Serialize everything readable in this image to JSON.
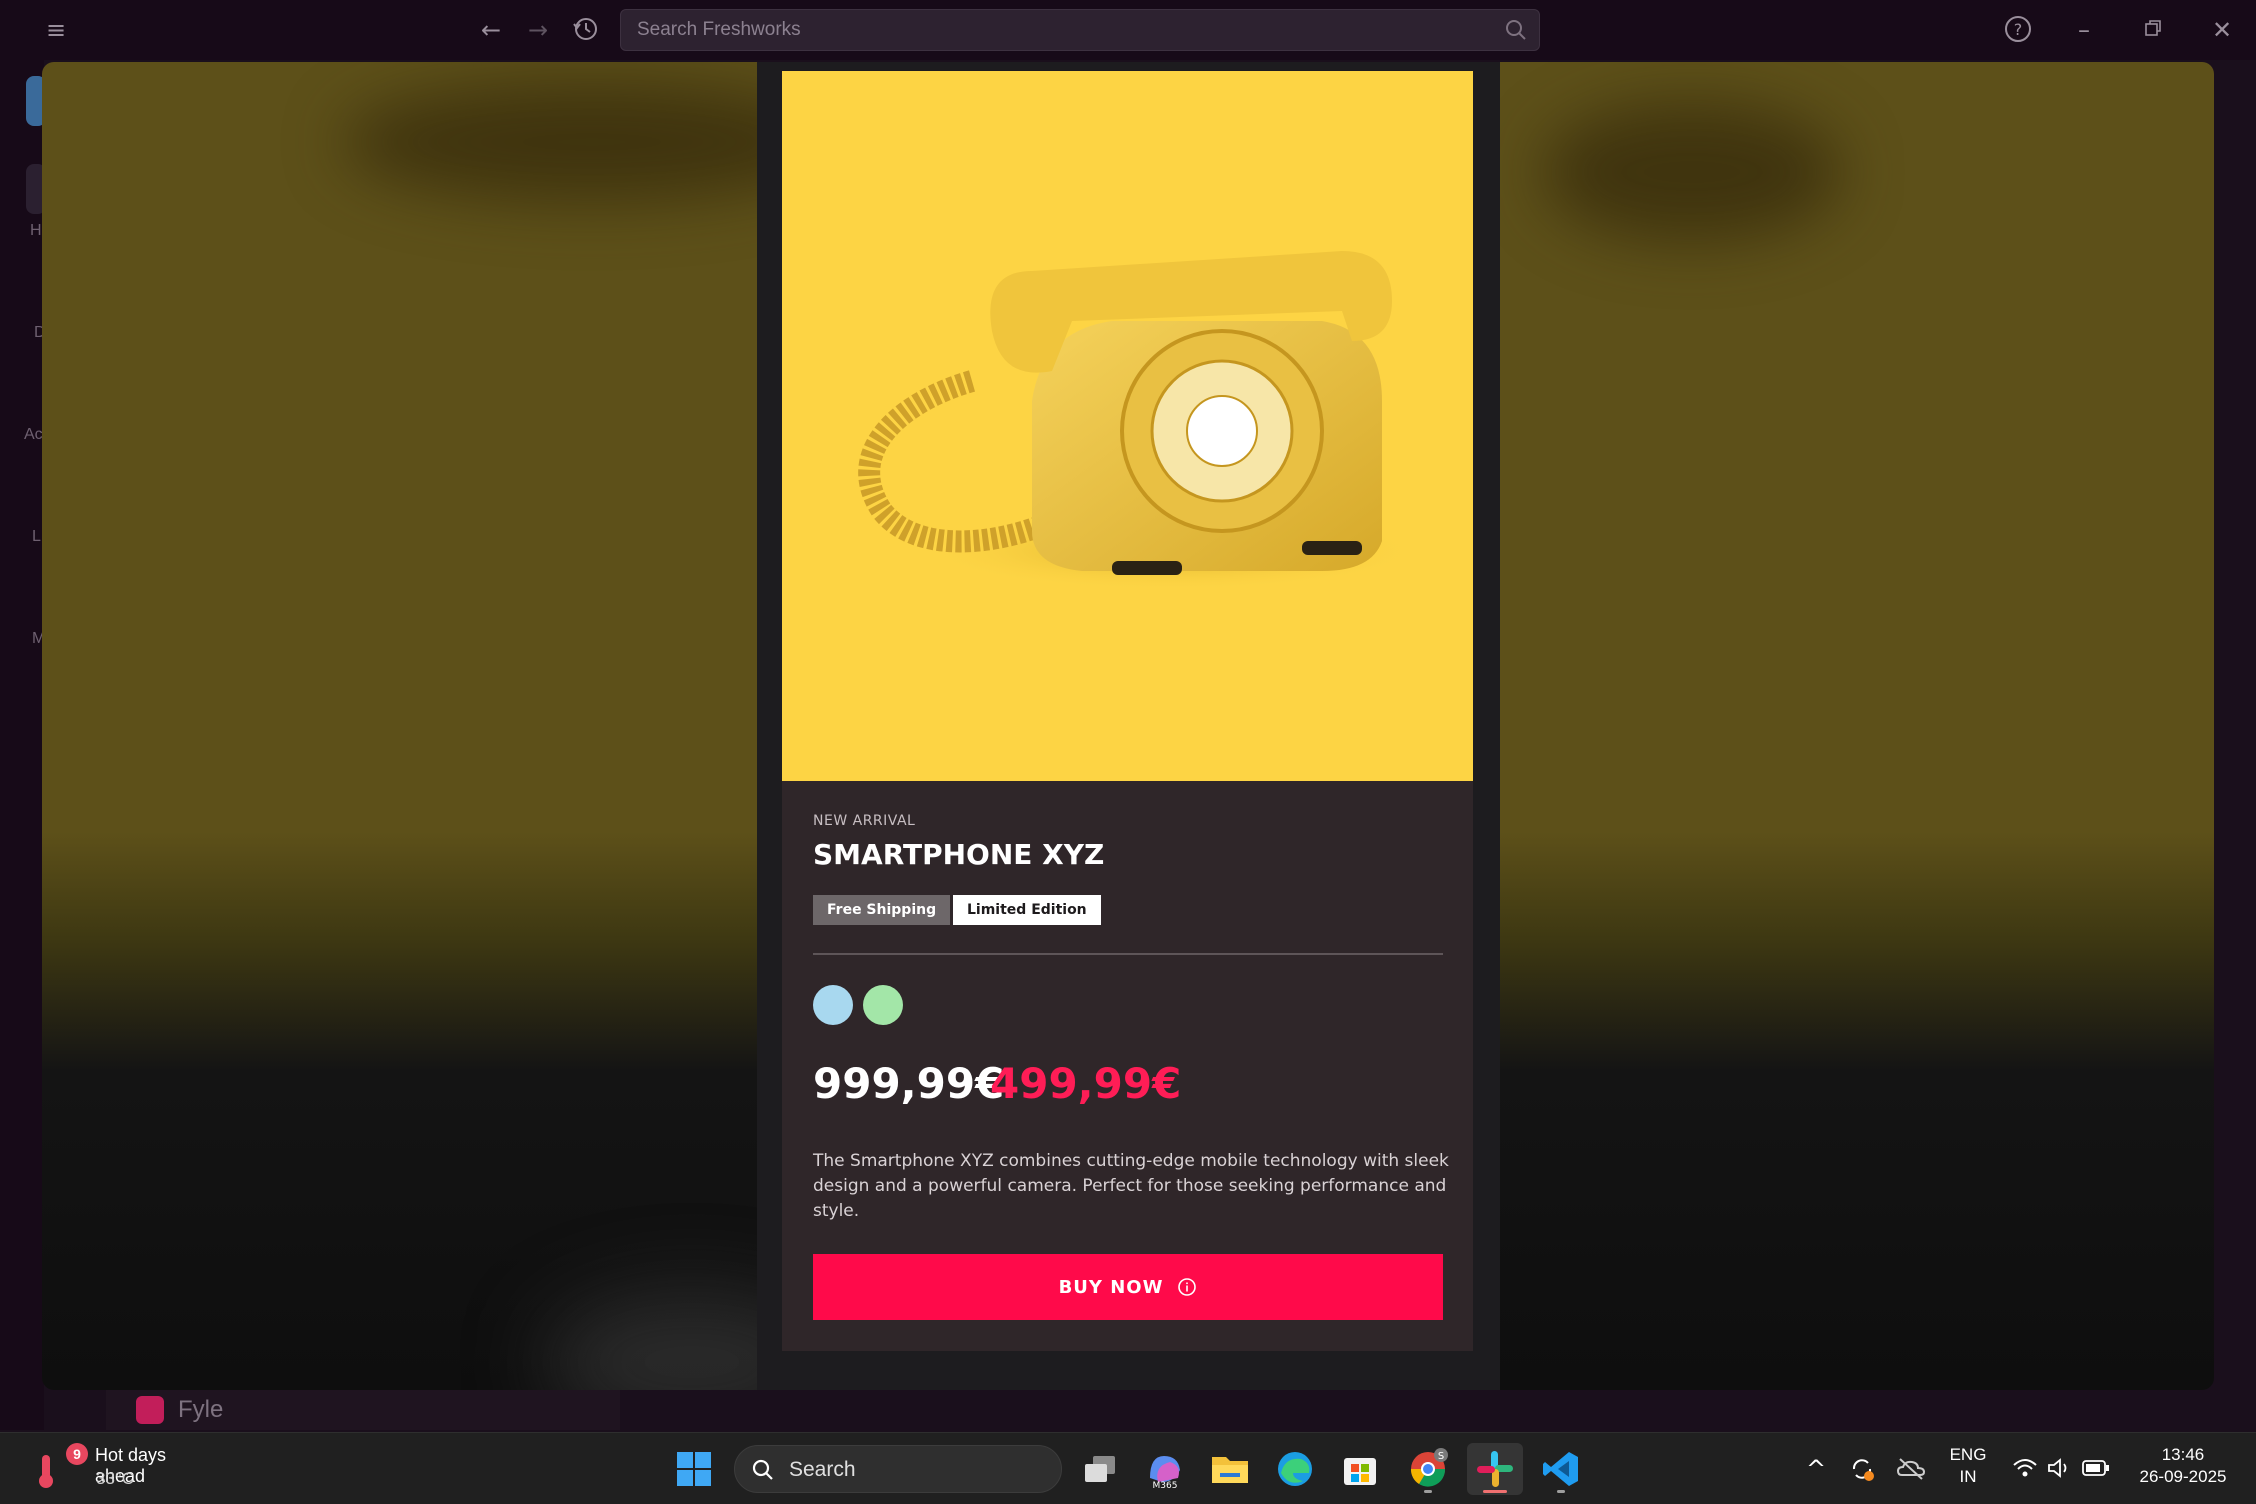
{
  "search": {
    "placeholder": "Search Freshworks"
  },
  "sidebar": {
    "fragments": [
      "H",
      "D",
      "Ac",
      "L",
      "M"
    ]
  },
  "product": {
    "eyebrow": "NEW ARRIVAL",
    "title": "SMARTPHONE XYZ",
    "tags": [
      "Free Shipping",
      "Limited Edition"
    ],
    "swatches": [
      "#a8d8ef",
      "#a3e6a8"
    ],
    "price_old": "999,99€",
    "price_new": "499,99€",
    "description": "The Smartphone XYZ combines cutting-edge mobile technology with sleek design and a powerful camera. Perfect for those seeking performance and style.",
    "buy_label": "BUY NOW",
    "image": "yellow-rotary-telephone"
  },
  "background_app": {
    "name": "Fyle"
  },
  "colors": {
    "accent": "#ff0a4a",
    "sale_price": "#ff1d56",
    "image_bg": "#fdd444"
  },
  "taskbar": {
    "weather": {
      "badge": "9",
      "title": "Hot days ahead",
      "temp": "33°C"
    },
    "search_label": "Search",
    "apps": [
      "windows-start",
      "search",
      "task-view",
      "m365-copilot",
      "file-explorer",
      "edge",
      "microsoft-store",
      "chrome",
      "slack",
      "vscode"
    ],
    "chrome_badge": "S",
    "m365_label": "M365",
    "language": {
      "line1": "ENG",
      "line2": "IN"
    },
    "clock": {
      "time": "13:46",
      "date": "26-09-2025"
    }
  }
}
